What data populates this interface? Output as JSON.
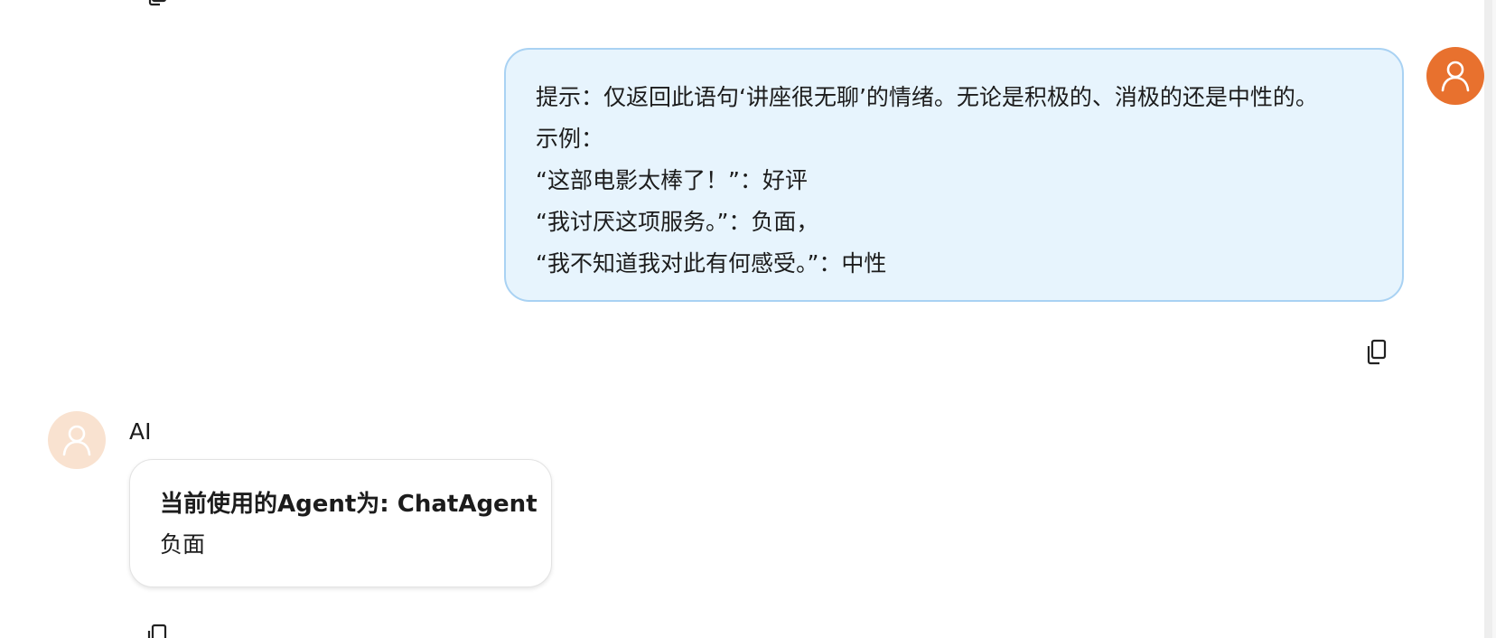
{
  "user_message": {
    "lines": [
      "提示：仅返回此语句‘讲座很无聊’的情绪。无论是积极的、消极的还是中性的。",
      "示例：",
      "“这部电影太棒了！”：好评",
      "“我讨厌这项服务。”：负面，",
      "“我不知道我对此有何感受。”：中性"
    ]
  },
  "ai_message": {
    "sender": "AI",
    "agent_line": "当前使用的Agent为: ChatAgent",
    "answer": "负面"
  },
  "icons": {
    "user_avatar": "user-icon",
    "ai_avatar": "user-icon",
    "copy": "copy-icon"
  },
  "colors": {
    "user_avatar_bg": "#e8712e",
    "ai_avatar_bg": "#f9e2d0",
    "user_bubble_bg": "#e7f4fd",
    "user_bubble_border": "#a9d2f3"
  }
}
